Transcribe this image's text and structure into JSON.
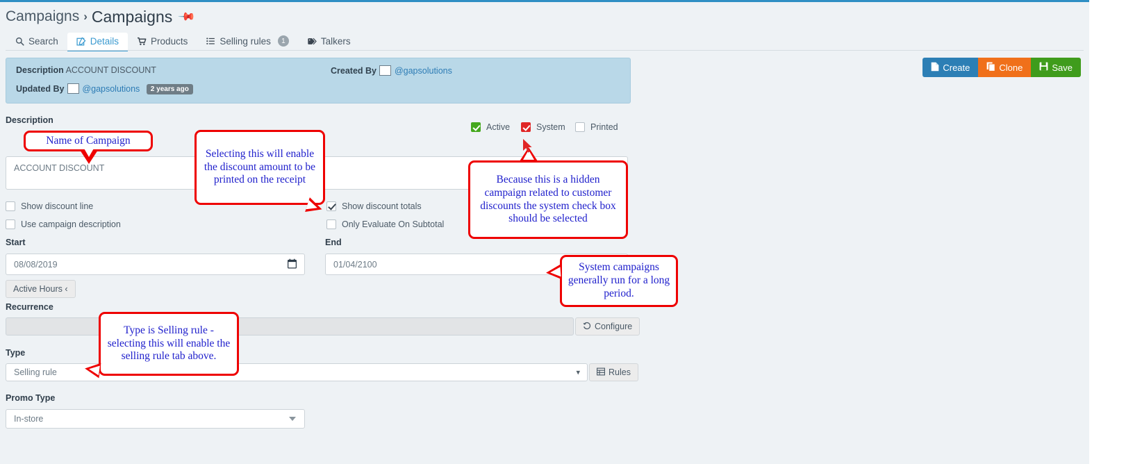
{
  "breadcrumb": {
    "parent": "Campaigns",
    "separator": "›",
    "current": "Campaigns",
    "pin_icon": "pin-icon"
  },
  "tabs": [
    {
      "label": "Search",
      "icon": "search-icon",
      "active": false,
      "badge": ""
    },
    {
      "label": "Details",
      "icon": "edit-square-icon",
      "active": true,
      "badge": ""
    },
    {
      "label": "Products",
      "icon": "cart-icon",
      "active": false,
      "badge": ""
    },
    {
      "label": "Selling rules",
      "icon": "list-icon",
      "active": false,
      "badge": "1"
    },
    {
      "label": "Talkers",
      "icon": "tag-icon",
      "active": false,
      "badge": ""
    }
  ],
  "info_panel": {
    "description_label": "Description",
    "description_value": "ACCOUNT DISCOUNT",
    "created_by_label": "Created By",
    "created_by_user": "@gapsolutions",
    "updated_by_label": "Updated By",
    "updated_by_user": "@gapsolutions",
    "updated_ago": "2 years ago"
  },
  "actions": [
    {
      "label": "Create",
      "icon": "file-icon",
      "color": "#2c7fb5"
    },
    {
      "label": "Clone",
      "icon": "copy-icon",
      "color": "#f0701a"
    },
    {
      "label": "Save",
      "icon": "floppy-icon",
      "color": "#3f9c1c"
    }
  ],
  "form": {
    "description_label": "Description",
    "description_value": "ACCOUNT DISCOUNT",
    "start_label": "Start",
    "start_value": "08/08/2019",
    "end_label": "End",
    "end_value": "01/04/2100",
    "active_hours_label": "Active Hours ‹",
    "recurrence_label": "Recurrence",
    "recurrence_value": "",
    "configure_label": "Configure",
    "type_label": "Type",
    "type_value": "Selling rule",
    "rules_label": "Rules",
    "promo_type_label": "Promo Type",
    "promo_type_value": "In-store"
  },
  "status_checkboxes": [
    {
      "label": "Active",
      "state": "checked-green"
    },
    {
      "label": "System",
      "state": "checked-red"
    },
    {
      "label": "Printed",
      "state": "unchecked"
    }
  ],
  "option_checkboxes": [
    {
      "label": "Show discount line",
      "state": "unchecked"
    },
    {
      "label": "Use campaign description",
      "state": "unchecked"
    },
    {
      "label": "Show discount totals",
      "state": "checked-plain"
    },
    {
      "label": "Only Evaluate On Subtotal",
      "state": "unchecked"
    }
  ],
  "annotations": [
    {
      "id": "name-of-campaign",
      "text": "Name of Campaign"
    },
    {
      "id": "printed-receipt",
      "text": "Selecting this will enable the discount amount to be printed on the receipt"
    },
    {
      "id": "hidden-campaign",
      "text": "Because this is a hidden campaign related to customer discounts the system check box should be selected"
    },
    {
      "id": "long-period",
      "text": "System campaigns generally run for a long period."
    },
    {
      "id": "selling-rule-type",
      "text": "Type is Selling rule - selecting this will enable the selling rule tab above."
    }
  ],
  "colors": {
    "accent": "#2f8fc4",
    "panel": "#b9d8e8",
    "annotation_border": "#ee0000",
    "annotation_text": "#2020cc",
    "active_check": "#45a81e",
    "system_check": "#e02626"
  }
}
